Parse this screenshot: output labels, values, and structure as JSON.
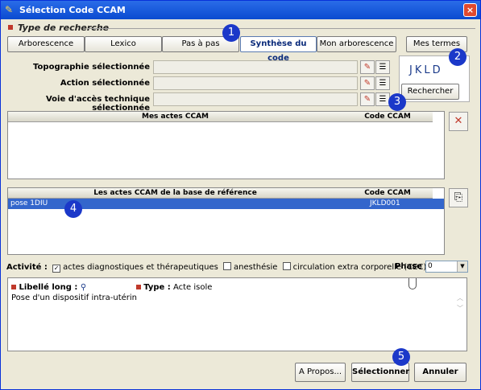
{
  "window": {
    "title": "Sélection Code CCAM",
    "close_symbol": "×"
  },
  "section": {
    "title": "Type de recherche"
  },
  "tabs": [
    "Arborescence",
    "Lexico",
    "Pas à pas",
    "Synthèse du code",
    "Mon arborescence",
    "Mes termes"
  ],
  "active_tab": "Synthèse du code",
  "fields": {
    "topographie_label": "Topographie sélectionnée",
    "action_label": "Action sélectionnée",
    "voie_label": "Voie d'accès technique sélectionnée",
    "topographie_value": "",
    "action_value": "",
    "voie_value": ""
  },
  "code_display": {
    "code": "JKLD",
    "search_button": "Rechercher"
  },
  "mes_actes": {
    "col_actes": "Mes actes CCAM",
    "col_code": "Code CCAM",
    "remove_symbol": "✕"
  },
  "reference": {
    "col_actes": "Les actes CCAM de la base de référence",
    "col_code": "Code CCAM",
    "rows": [
      {
        "label": "pose 1DIU",
        "code": "JKLD001"
      }
    ]
  },
  "activity": {
    "label": "Activité :",
    "options": [
      {
        "label": "actes diagnostiques et thérapeutiques",
        "checked": true
      },
      {
        "label": "anesthésie",
        "checked": false
      },
      {
        "label": "circulation extra corporelle (CEC)",
        "checked": false
      }
    ],
    "phase_label": "Phase :",
    "phase_value": "0"
  },
  "details": {
    "libelle_label": "Libellé long :",
    "type_label": "Type :",
    "type_value": "Acte isole",
    "libelle_text": "Pose d'un dispositif intra-utérin"
  },
  "footer": {
    "apropos": "A Propos...",
    "select": "Sélectionner",
    "cancel": "Annuler"
  },
  "bubbles": [
    "1",
    "2",
    "3",
    "4",
    "5"
  ],
  "colors": {
    "accent": "#1b38c9",
    "selection": "#3366cc",
    "title_bar": "#0a4bd0"
  }
}
